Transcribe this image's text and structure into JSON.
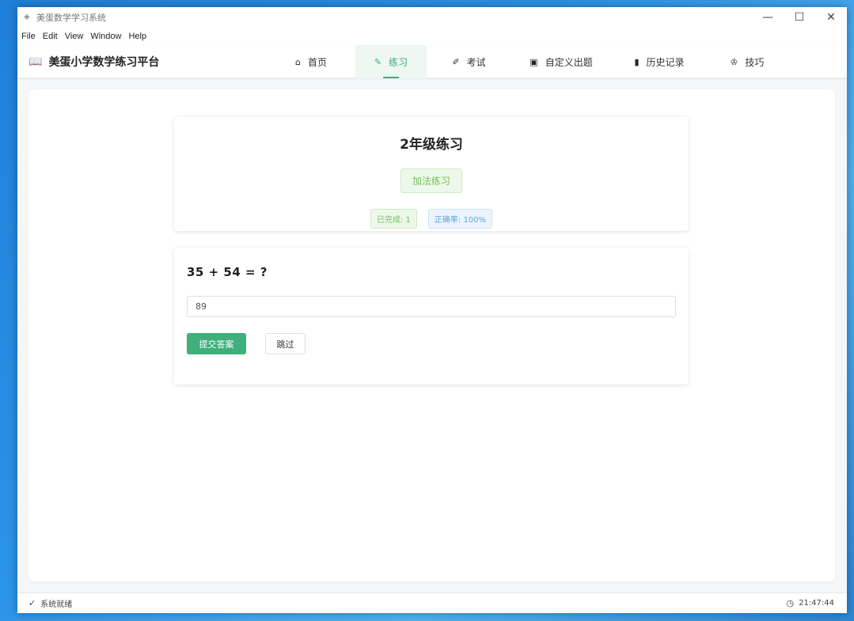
{
  "window": {
    "title": "美蛋数学学习系统",
    "app_icon": "app-icon",
    "controls": {
      "minimize": "—",
      "maximize": "☐",
      "close": "✕"
    }
  },
  "menu": [
    "File",
    "Edit",
    "View",
    "Window",
    "Help"
  ],
  "brand": {
    "icon": "book-icon",
    "name": "美蛋小学数学练习平台"
  },
  "nav": [
    {
      "label": "首页",
      "icon": "home-icon",
      "glyph": "⌂",
      "active": false
    },
    {
      "label": "练习",
      "icon": "edit-icon",
      "glyph": "✎",
      "active": true
    },
    {
      "label": "考试",
      "icon": "edit-square-icon",
      "glyph": "✐",
      "active": false
    },
    {
      "label": "自定义出题",
      "icon": "image-icon",
      "glyph": "▣",
      "active": false
    },
    {
      "label": "历史记录",
      "icon": "bar-chart-icon",
      "glyph": "▮",
      "active": false
    },
    {
      "label": "技巧",
      "icon": "trophy-icon",
      "glyph": "♔",
      "active": false
    }
  ],
  "practice": {
    "title": "2年级练习",
    "mode": "加法练习",
    "completed": "已完成: 1",
    "accuracy": "正确率: 100%"
  },
  "question": {
    "text": "35 + 54 = ?",
    "answer_value": "89",
    "submit_label": "提交答案",
    "skip_label": "跳过"
  },
  "status": {
    "text": "系统就绪",
    "time": "21:47:44"
  }
}
